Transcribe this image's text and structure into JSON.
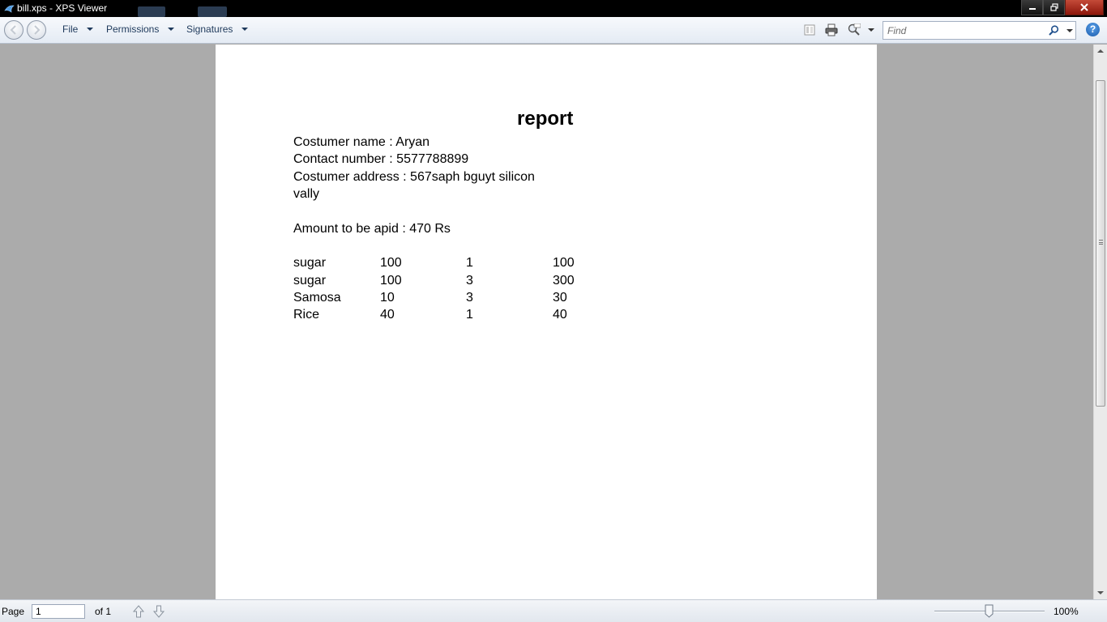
{
  "window": {
    "title": "bill.xps - XPS Viewer"
  },
  "toolbar": {
    "menus": [
      {
        "label": "File"
      },
      {
        "label": "Permissions"
      },
      {
        "label": "Signatures"
      }
    ],
    "search_placeholder": "Find"
  },
  "document": {
    "title": "report",
    "customer_line": "Costumer name : Aryan",
    "contact_line": "Contact number : 5577788899",
    "address_line1": "Costumer address : 567saph bguyt silicon",
    "address_line2": "vally",
    "amount_line": "Amount to be apid : 470  Rs",
    "items": [
      {
        "name": "sugar",
        "price": "100",
        "qty": "1",
        "total": "100"
      },
      {
        "name": "sugar",
        "price": "100",
        "qty": "3",
        "total": "300"
      },
      {
        "name": "Samosa",
        "price": "10",
        "qty": "3",
        "total": "30"
      },
      {
        "name": "Rice",
        "price": "40",
        "qty": "1",
        "total": "40"
      }
    ]
  },
  "statusbar": {
    "page_label": "Page",
    "page_value": "1",
    "page_count": "of 1",
    "zoom": "100%"
  },
  "colors": {
    "titlebar": "#000000",
    "toolbar_text": "#1e395b",
    "viewport_bg": "#ababab",
    "page_bg": "#ffffff"
  },
  "icons": [
    "app-icon",
    "back-icon",
    "forward-icon",
    "page-view-icon",
    "print-icon",
    "zoom-icon",
    "search-icon",
    "help-icon",
    "page-up-icon",
    "page-down-icon"
  ]
}
